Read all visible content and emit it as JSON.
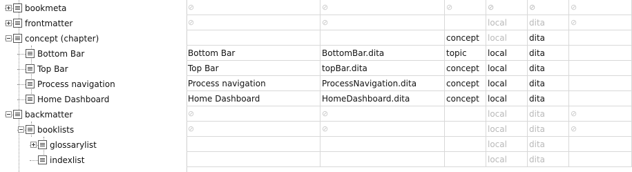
{
  "tree": [
    {
      "label": "bookmeta",
      "toggle": "plus"
    },
    {
      "label": "frontmatter",
      "toggle": "plus"
    },
    {
      "label": "concept (chapter)",
      "toggle": "minus"
    },
    {
      "label": "Bottom Bar"
    },
    {
      "label": "Top Bar"
    },
    {
      "label": "Process navigation"
    },
    {
      "label": "Home Dashboard"
    },
    {
      "label": "backmatter",
      "toggle": "minus"
    },
    {
      "label": "booklists",
      "toggle": "minus"
    },
    {
      "label": "glossarylist",
      "toggle": "plus"
    },
    {
      "label": "indexlist"
    }
  ],
  "null_glyph": "⊘",
  "rows": [
    {
      "cells": [
        "⊘",
        "⊘",
        "⊘",
        "⊘",
        "⊘",
        "⊘"
      ],
      "muted": [
        3,
        4
      ]
    },
    {
      "cells": [
        "⊘",
        "⊘",
        "",
        "local",
        "dita",
        "⊘"
      ],
      "muted": [
        3,
        4
      ]
    },
    {
      "cells": [
        "",
        "",
        "concept",
        "local",
        "dita",
        ""
      ],
      "muted": [
        3
      ]
    },
    {
      "cells": [
        "Bottom Bar",
        "BottomBar.dita",
        "topic",
        "local",
        "dita",
        ""
      ],
      "muted": []
    },
    {
      "cells": [
        "Top Bar",
        "topBar.dita",
        "concept",
        "local",
        "dita",
        ""
      ],
      "muted": []
    },
    {
      "cells": [
        "Process navigation",
        "ProcessNavigation.dita",
        "concept",
        "local",
        "dita",
        ""
      ],
      "muted": []
    },
    {
      "cells": [
        "Home Dashboard",
        "HomeDashboard.dita",
        "concept",
        "local",
        "dita",
        ""
      ],
      "muted": []
    },
    {
      "cells": [
        "⊘",
        "⊘",
        "",
        "local",
        "dita",
        "⊘"
      ],
      "muted": [
        3,
        4
      ]
    },
    {
      "cells": [
        "⊘",
        "⊘",
        "",
        "local",
        "dita",
        "⊘"
      ],
      "muted": [
        3,
        4
      ]
    },
    {
      "cells": [
        "",
        "",
        "",
        "local",
        "dita",
        ""
      ],
      "muted": [
        3,
        4
      ]
    },
    {
      "cells": [
        "",
        "",
        "",
        "local",
        "dita",
        ""
      ],
      "muted": [
        3,
        4
      ]
    }
  ]
}
